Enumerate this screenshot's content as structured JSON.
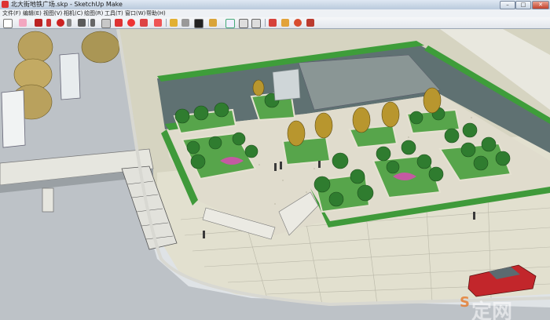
{
  "window": {
    "title": "北大街地铁广场.skp - SketchUp Make"
  },
  "window_controls": {
    "minimize": "–",
    "maximize": "□",
    "close": "✕"
  },
  "menubar": {
    "items": [
      "文件(F)",
      "编辑(E)",
      "视图(V)",
      "相机(C)",
      "绘图(R)",
      "工具(T)",
      "窗口(W)",
      "帮助(H)"
    ]
  },
  "toolbar": {
    "tools": [
      "select-icon",
      "eraser-icon",
      "pencil-icon",
      "arc-icon",
      "shape-icon",
      "rectangle-icon",
      "paint-bucket-icon",
      "pushpull-icon",
      "move-icon",
      "rotate-icon",
      "offset-icon",
      "tape-measure-icon",
      "text-icon",
      "axes-icon",
      "dimension-icon",
      "protractor-icon",
      "section-icon",
      "orbit-icon",
      "pan-icon",
      "zoom-icon",
      "zoom-extents-icon",
      "warehouse-icon",
      "components-icon",
      "extension-icon"
    ]
  },
  "watermark": {
    "text": "定网",
    "mark": "S"
  },
  "colors": {
    "grass": "#3e9d3a",
    "water": "#5f7072",
    "paving": "#d9d7c5",
    "road": "#bcc1c6",
    "car": "#c2262b"
  }
}
